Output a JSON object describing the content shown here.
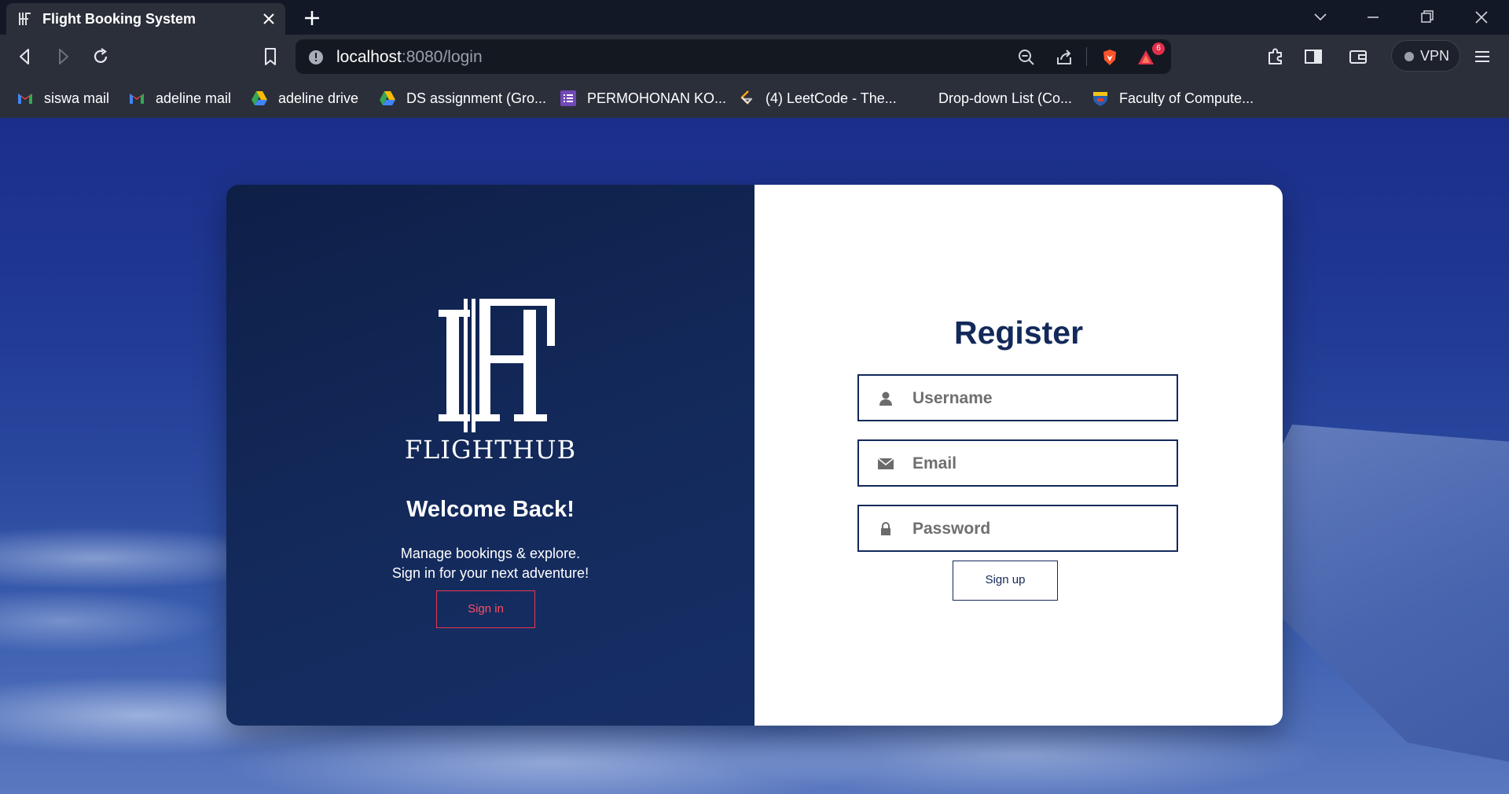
{
  "browser": {
    "tab_title": "Flight Booking System",
    "url_host": "localhost",
    "url_rest": ":8080/login",
    "vpn_label": "VPN",
    "notification_count": "6",
    "icons": {
      "back": "back-arrow-icon",
      "forward": "forward-arrow-icon",
      "reload": "reload-icon",
      "bookmark": "bookmark-icon",
      "site_info": "info-icon",
      "zoom": "zoom-out-icon",
      "share": "share-icon",
      "brave": "brave-shield-icon",
      "rewards": "rewards-triangle-icon",
      "extensions": "puzzle-icon",
      "sidebar": "sidebar-icon",
      "wallet": "wallet-icon",
      "menu": "hamburger-menu-icon"
    }
  },
  "bookmarks": [
    {
      "label": "siswa mail",
      "icon": "gmail-icon"
    },
    {
      "label": "adeline mail",
      "icon": "gmail-icon"
    },
    {
      "label": "adeline drive",
      "icon": "drive-icon"
    },
    {
      "label": "DS assignment (Gro...",
      "icon": "drive-icon"
    },
    {
      "label": "PERMOHONAN KO...",
      "icon": "forms-icon"
    },
    {
      "label": "(4) LeetCode - The...",
      "icon": "leetcode-icon"
    },
    {
      "label": "Drop-down List (Co...",
      "icon": ""
    },
    {
      "label": "Faculty of Compute...",
      "icon": "faculty-crest-icon"
    }
  ],
  "brand": {
    "name": "FLIGHTHUB",
    "colors": {
      "navy": "#13295a",
      "accent_red": "#e63950"
    }
  },
  "left_panel": {
    "heading": "Welcome Back!",
    "subtext_line1": "Manage bookings & explore.",
    "subtext_line2": "Sign in for your next adventure!",
    "signin_label": "Sign in"
  },
  "register": {
    "title": "Register",
    "username_placeholder": "Username",
    "email_placeholder": "Email",
    "password_placeholder": "Password",
    "signup_label": "Sign up"
  }
}
